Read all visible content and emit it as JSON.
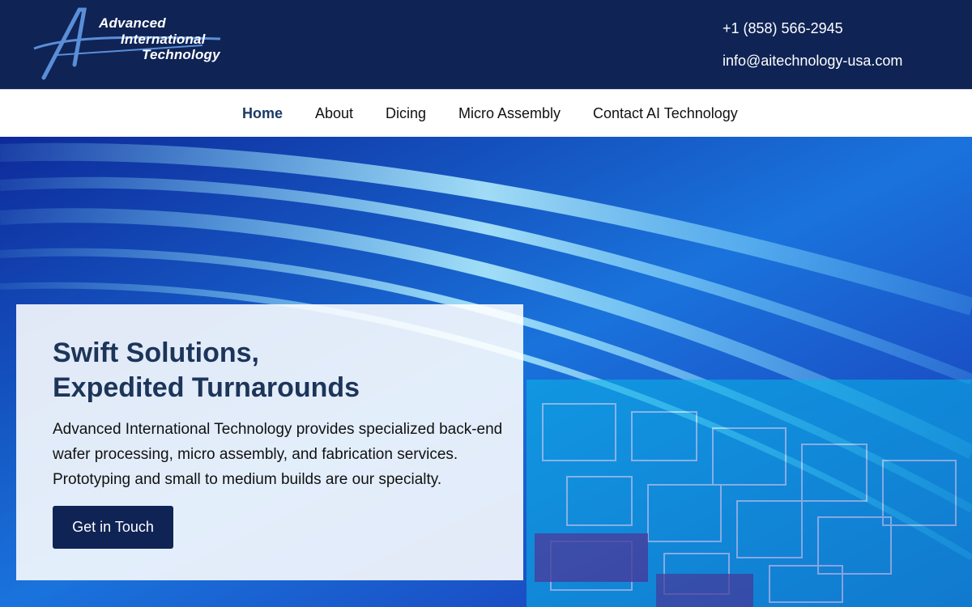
{
  "header": {
    "logo": {
      "line1": "Advanced",
      "line2": "International",
      "line3": "Technology"
    },
    "phone": "+1 (858) 566-2945",
    "email": "info@aitechnology-usa.com"
  },
  "nav": {
    "items": [
      {
        "label": "Home",
        "active": true
      },
      {
        "label": "About"
      },
      {
        "label": "Dicing"
      },
      {
        "label": "Micro Assembly"
      },
      {
        "label": "Contact AI Technology"
      }
    ]
  },
  "hero": {
    "headline_line1": "Swift Solutions,",
    "headline_line2": "Expedited Turnarounds",
    "body": "Advanced International Technology provides specialized back-end wafer processing, micro assembly, and fabrication services. Prototyping and small to medium builds are our specialty.",
    "cta_label": "Get in Touch"
  },
  "colors": {
    "header_bg": "#0f2355",
    "accent_text": "#1c3559",
    "button_bg": "#0f2355"
  }
}
